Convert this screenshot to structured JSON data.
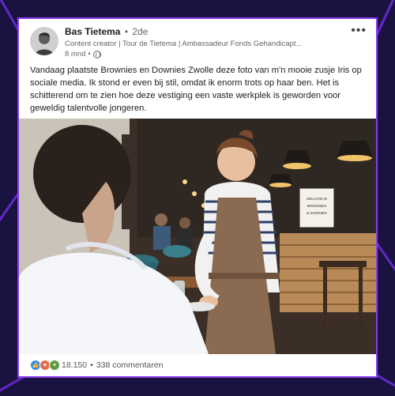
{
  "post": {
    "author_name": "Bas Tietema",
    "connection_degree": "2de",
    "author_subtitle": "Content creator | Tour de Tietema | Ambassadeur Fonds Gehandicapt...",
    "time_ago": "8 mnd",
    "text": "Vandaag plaatste Brownies en Downies Zwolle deze foto van m'n mooie zusje Iris op sociale media. Ik stond er even bij stil, omdat ik enorm trots op haar ben. Het is schitterend om te zien hoe deze vestiging een vaste werkplek is geworden voor geweldig talentvolle jongeren.",
    "more_icon": "more-horizontal-icon",
    "visibility_icon": "globe-icon"
  },
  "photo": {
    "sign_text": [
      "WELCOM IN",
      "BROWNIES",
      "& DOWNIES"
    ]
  },
  "footer": {
    "reaction_count": "18.150",
    "separator": "•",
    "comments": "338 commentaren",
    "reaction_icons": [
      "like-icon",
      "love-icon",
      "insightful-icon"
    ]
  },
  "colors": {
    "background": "#1a1240",
    "accent": "#8a3cf0",
    "like": "#378fe9",
    "love": "#df704d",
    "insightful": "#5f9b41"
  }
}
